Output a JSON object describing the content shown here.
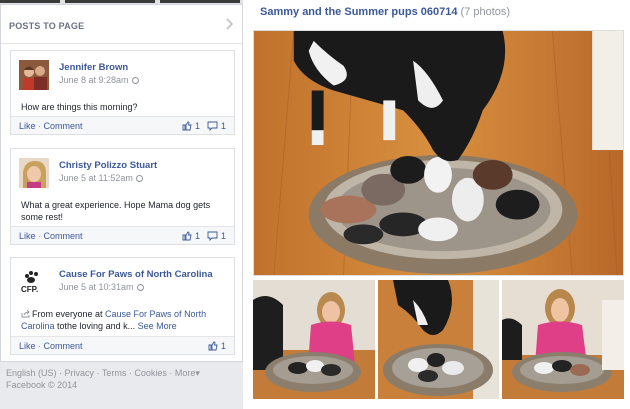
{
  "posts_panel": {
    "title": "POSTS TO PAGE"
  },
  "posts": [
    {
      "author": "Jennifer Brown",
      "time": "June 8 at 9:28am",
      "text": "How are things this morning?",
      "like_label": "Like",
      "comment_label": "Comment",
      "likes": "1",
      "comments": "1"
    },
    {
      "author": "Christy Polizzo Stuart",
      "time": "June 5 at 11:52am",
      "text": "What a great experience. Hope Mama dog gets some rest!",
      "like_label": "Like",
      "comment_label": "Comment",
      "likes": "1",
      "comments": "1"
    },
    {
      "author": "Cause For Paws of North Carolina",
      "time": "June 5 at 10:31am",
      "text_prefix": "From everyone at ",
      "text_link": "Cause For Paws of North Carolina",
      "text_rest": " tothe loving and k...",
      "see_more": "See More",
      "like_label": "Like",
      "comment_label": "Comment",
      "likes": "1"
    }
  ],
  "footer": {
    "links": [
      "English (US)",
      "Privacy",
      "Terms",
      "Cookies",
      "More"
    ],
    "copyright": "Facebook © 2014"
  },
  "album": {
    "title": "Sammy and the Summer pups 060714",
    "photo_count": "(7 photos)"
  },
  "colors": {
    "link": "#3b5998",
    "muted": "#90949c",
    "background": "#e9eaed"
  },
  "icons": {
    "chevron": "chevron-right-icon",
    "globe": "globe-icon",
    "like": "thumbs-up-icon",
    "comment": "comment-icon",
    "share": "share-icon"
  }
}
